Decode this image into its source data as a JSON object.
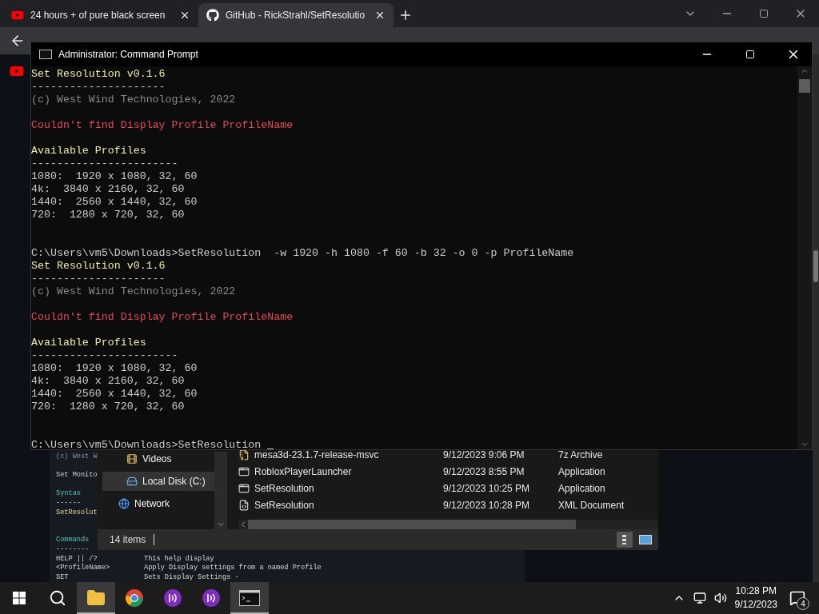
{
  "browser": {
    "tabs": [
      {
        "title": "24 hours + of pure black screen",
        "kind": "video",
        "selected": false
      },
      {
        "title": "GitHub - RickStrahl/SetResolutio",
        "kind": "code",
        "selected": true
      }
    ]
  },
  "background_doc": {
    "lines": [
      {
        "kind": "dim",
        "text": "(c) West W"
      },
      {
        "kind": "blank"
      },
      {
        "kind": "text",
        "text": "Set Monito"
      },
      {
        "kind": "blank"
      },
      {
        "kind": "heading",
        "text": "Syntax"
      },
      {
        "kind": "text",
        "text": "------"
      },
      {
        "kind": "accent",
        "text": "SetResolut"
      },
      {
        "kind": "blank"
      },
      {
        "kind": "blank"
      },
      {
        "kind": "heading",
        "text": "Commands"
      },
      {
        "kind": "text",
        "text": "--------"
      }
    ],
    "help_rows": [
      {
        "command": "HELP || /?",
        "description": "This help display"
      },
      {
        "command": "<ProfileName>",
        "description": "Apply Display settings from a named Profile"
      },
      {
        "command": "SET",
        "description": "Sets Display Settings -"
      }
    ]
  },
  "explorer": {
    "nav": [
      {
        "label": "Videos",
        "kind": "videos",
        "selected": false
      },
      {
        "label": "Local Disk (C:)",
        "kind": "disk",
        "selected": true
      },
      {
        "label": "Network",
        "kind": "network",
        "selected": false
      }
    ],
    "files": [
      {
        "name": "mesa3d-23.1.7-release-msvc",
        "date": "9/12/2023 9:06 PM",
        "type": "7z Archive",
        "kind": "archive"
      },
      {
        "name": "RobloxPlayerLauncher",
        "date": "9/12/2023 8:55 PM",
        "type": "Application",
        "kind": "app"
      },
      {
        "name": "SetResolution",
        "date": "9/12/2023 10:25 PM",
        "type": "Application",
        "kind": "app"
      },
      {
        "name": "SetResolution",
        "date": "9/12/2023 10:28 PM",
        "type": "XML Document",
        "kind": "xml"
      }
    ],
    "status": "14 items"
  },
  "cmd": {
    "title": "Administrator: Command Prompt",
    "cursor_visible": true,
    "lines": [
      {
        "kind": "header",
        "text": "Set Resolution v0.1.6"
      },
      {
        "kind": "text",
        "text": "---------------------"
      },
      {
        "kind": "dim",
        "text": "(c) West Wind Technologies, 2022"
      },
      {
        "kind": "blank"
      },
      {
        "kind": "error",
        "text": "Couldn't find Display Profile ProfileName"
      },
      {
        "kind": "blank"
      },
      {
        "kind": "header",
        "text": "Available Profiles"
      },
      {
        "kind": "text",
        "text": "-----------------------"
      },
      {
        "kind": "text",
        "text": "1080:  1920 x 1080, 32, 60"
      },
      {
        "kind": "text",
        "text": "4k:  3840 x 2160, 32, 60"
      },
      {
        "kind": "text",
        "text": "1440:  2560 x 1440, 32, 60"
      },
      {
        "kind": "text",
        "text": "720:  1280 x 720, 32, 60"
      },
      {
        "kind": "blank"
      },
      {
        "kind": "blank"
      },
      {
        "kind": "text",
        "text": "C:\\Users\\vm5\\Downloads>SetResolution  -w 1920 -h 1080 -f 60 -b 32 -o 0 -p ProfileName"
      },
      {
        "kind": "header",
        "text": "Set Resolution v0.1.6"
      },
      {
        "kind": "text",
        "text": "---------------------"
      },
      {
        "kind": "dim",
        "text": "(c) West Wind Technologies, 2022"
      },
      {
        "kind": "blank"
      },
      {
        "kind": "error",
        "text": "Couldn't find Display Profile ProfileName"
      },
      {
        "kind": "blank"
      },
      {
        "kind": "header",
        "text": "Available Profiles"
      },
      {
        "kind": "text",
        "text": "-----------------------"
      },
      {
        "kind": "text",
        "text": "1080:  1920 x 1080, 32, 60"
      },
      {
        "kind": "text",
        "text": "4k:  3840 x 2160, 32, 60"
      },
      {
        "kind": "text",
        "text": "1440:  2560 x 1440, 32, 60"
      },
      {
        "kind": "text",
        "text": "720:  1280 x 720, 32, 60"
      },
      {
        "kind": "blank"
      },
      {
        "kind": "blank"
      },
      {
        "kind": "prompt",
        "text": "C:\\Users\\vm5\\Downloads>SetResolution "
      }
    ]
  },
  "taskbar": {
    "apps": [
      {
        "kind": "explorer",
        "active": true
      },
      {
        "kind": "chrome",
        "active": false
      },
      {
        "kind": "purple",
        "active": false
      },
      {
        "kind": "purple",
        "active": false
      },
      {
        "kind": "terminal",
        "active": true
      }
    ],
    "time": "10:28 PM",
    "date": "9/12/2023",
    "notifications": "4"
  }
}
